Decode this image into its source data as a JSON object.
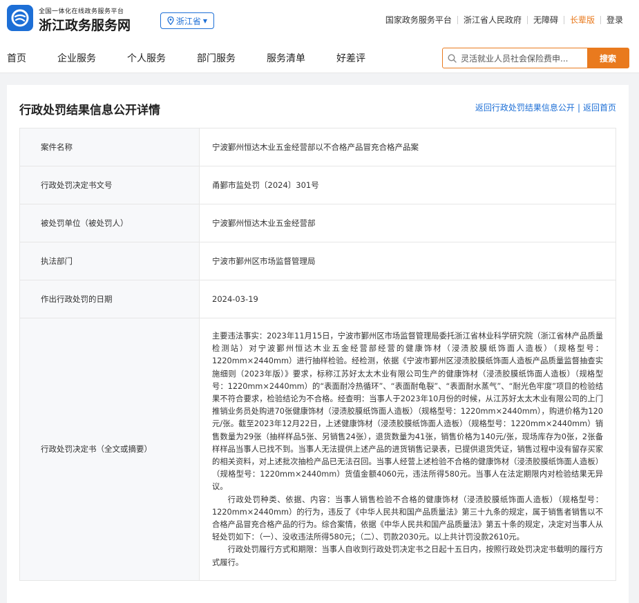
{
  "header": {
    "brand_sub": "全国一体化在线政务服务平台",
    "brand_main": "浙江政务服务网",
    "region": "浙江省",
    "links": [
      "国家政务服务平台",
      "浙江省人民政府",
      "无障碍",
      "长辈版",
      "登录"
    ]
  },
  "nav": {
    "items": [
      "首页",
      "企业服务",
      "个人服务",
      "部门服务",
      "服务清单",
      "好差评"
    ],
    "search_value": "灵活就业人员社会保险费申...",
    "search_button": "搜索"
  },
  "page": {
    "title": "行政处罚结果信息公开详情",
    "back_list": "返回行政处罚结果信息公开",
    "back_home": "返回首页",
    "separator": "|"
  },
  "rows": [
    {
      "label": "案件名称",
      "value": "宁波鄞州恒达木业五金经营部以不合格产品冒充合格产品案"
    },
    {
      "label": "行政处罚决定书文号",
      "value": "甬鄞市监处罚〔2024〕301号"
    },
    {
      "label": "被处罚单位（被处罚人）",
      "value": "宁波鄞州恒达木业五金经营部"
    },
    {
      "label": "执法部门",
      "value": "宁波市鄞州区市场监督管理局"
    },
    {
      "label": "作出行政处罚的日期",
      "value": "2024-03-19"
    }
  ],
  "decision": {
    "label": "行政处罚决定书（全文或摘要）",
    "paragraphs": [
      "主要违法事实：2023年11月15日，宁波市鄞州区市场监督管理局委托浙江省林业科学研究院（浙江省林产品质量检测站）对宁波鄞州恒达木业五金经营部经营的健康饰材（浸渍胶膜纸饰面人造板）（规格型号：1220mm×2440mm）进行抽样检验。经检测，依据《宁波市鄞州区浸渍胶膜纸饰面人造板产品质量监督抽查实施细则（2023年版）》要求，标称江苏好太太木业有限公司生产的健康饰材（浸渍胶膜纸饰面人造板）（规格型号：1220mm×2440mm）的“表面耐冷热循环”、“表面耐龟裂”、“表面耐水蒸气”、“耐光色牢度”项目的检验结果不符合要求，检验结论为不合格。经查明：当事人于2023年10月份的时候，从江苏好太太木业有限公司的上门推销业务员处购进70张健康饰材（浸渍胶膜纸饰面人造板）（规格型号：1220mm×2440mm），购进价格为120元/张。截至2023年12月22日，上述健康饰材（浸渍胶膜纸饰面人造板）（规格型号：1220mm×2440mm）销售数量为29张（抽样样品5张、另销售24张），退货数量为41张，销售价格为140元/张，现场库存为0张，2张备样样品当事人已找不到。当事人无法提供上述产品的进货销售记录表，已提供退货凭证，销售过程中没有留存买家的相关资料，对上述批次抽检产品已无法召回。当事人经营上述检验不合格的健康饰材（浸渍胶膜纸饰面人造板）（规格型号：1220mm×2440mm）货值金额4060元，违法所得580元。当事人在法定期限内对检验结果无异议。",
      "行政处罚种类、依据、内容：当事人销售检验不合格的健康饰材（浸渍胶膜纸饰面人造板）（规格型号：1220mm×2440mm）的行为，违反了《中华人民共和国产品质量法》第三十九条的规定，属于销售者销售以不合格产品冒充合格产品的行为。综合案情，依据《中华人民共和国产品质量法》第五十条的规定，决定对当事人从轻处罚如下：（一）、没收违法所得580元；（二）、罚款2030元。以上共计罚没款2610元。",
      "行政处罚履行方式和期限：当事人自收到行政处罚决定书之日起十五日内，按照行政处罚决定书载明的履行方式履行。"
    ]
  },
  "colors": {
    "primary": "#1d6fd6",
    "accent": "#e97a1e",
    "label_bg": "#f7f8fa",
    "page_bg": "#f2f3f5"
  },
  "icons": [
    "zhejiang-logo-icon",
    "location-pin-icon",
    "caret-down-icon",
    "search-icon"
  ]
}
